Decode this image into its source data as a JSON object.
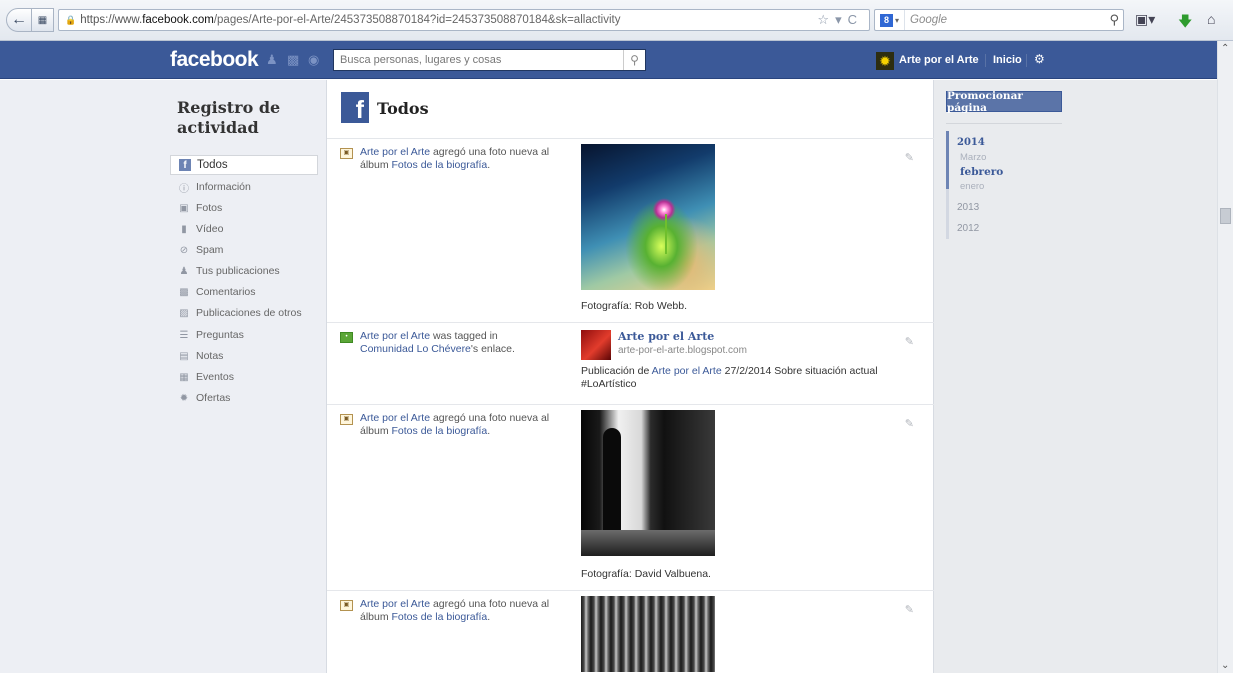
{
  "browser": {
    "url_prefix": "https://www.",
    "url_host": "facebook.com",
    "url_tail": "/pages/Arte-por-el-Arte/245373508870184?id=245373508870184&sk=allactivity",
    "search_engine": "Google",
    "search_placeholder": "Google"
  },
  "fb_header": {
    "logo": "facebook",
    "search_placeholder": "Busca personas, lugares y cosas",
    "page_name": "Arte por el Arte",
    "home_label": "Inicio"
  },
  "sidebar": {
    "title": "Registro de actividad",
    "items": [
      {
        "label": "Todos",
        "icon": "facebook-f-icon"
      },
      {
        "label": "Información",
        "icon": "info-icon"
      },
      {
        "label": "Fotos",
        "icon": "photo-icon"
      },
      {
        "label": "Vídeo",
        "icon": "video-icon"
      },
      {
        "label": "Spam",
        "icon": "spam-icon"
      },
      {
        "label": "Tus publicaciones",
        "icon": "person-icon"
      },
      {
        "label": "Comentarios",
        "icon": "comment-icon"
      },
      {
        "label": "Publicaciones de otros",
        "icon": "posts-icon"
      },
      {
        "label": "Preguntas",
        "icon": "questions-icon"
      },
      {
        "label": "Notas",
        "icon": "notes-icon"
      },
      {
        "label": "Eventos",
        "icon": "calendar-icon"
      },
      {
        "label": "Ofertas",
        "icon": "offers-icon"
      }
    ]
  },
  "content": {
    "title": "Todos",
    "activities": [
      {
        "actor": "Arte por el Arte",
        "verb": " agregó una foto nueva al álbum ",
        "link": "Fotos de la biografía",
        "end": ".",
        "caption": "Fotografía: Rob Webb."
      },
      {
        "actor": "Arte por el Arte",
        "verb": " was tagged in ",
        "link": "Comunidad Lo Chévere",
        "end": "'s enlace.",
        "link_title": "Arte por el Arte",
        "link_domain": "arte-por-el-arte.blogspot.com",
        "desc_prefix": "Publicación de ",
        "desc_link": "Arte por el Arte",
        "desc_rest": " 27/2/2014 Sobre situación actual #LoArtístico"
      },
      {
        "actor": "Arte por el Arte",
        "verb": " agregó una foto nueva al álbum ",
        "link": "Fotos de la biografía",
        "end": ".",
        "caption": "Fotografía: David Valbuena."
      },
      {
        "actor": "Arte por el Arte",
        "verb": " agregó una foto nueva al álbum ",
        "link": "Fotos de la biografía",
        "end": "."
      }
    ]
  },
  "right": {
    "promote_label": "Promocionar página",
    "timeline": [
      {
        "label": "2014"
      },
      {
        "label": "Marzo"
      },
      {
        "label": "febrero"
      },
      {
        "label": "enero"
      },
      {
        "label": "2013"
      },
      {
        "label": "2012"
      }
    ]
  }
}
